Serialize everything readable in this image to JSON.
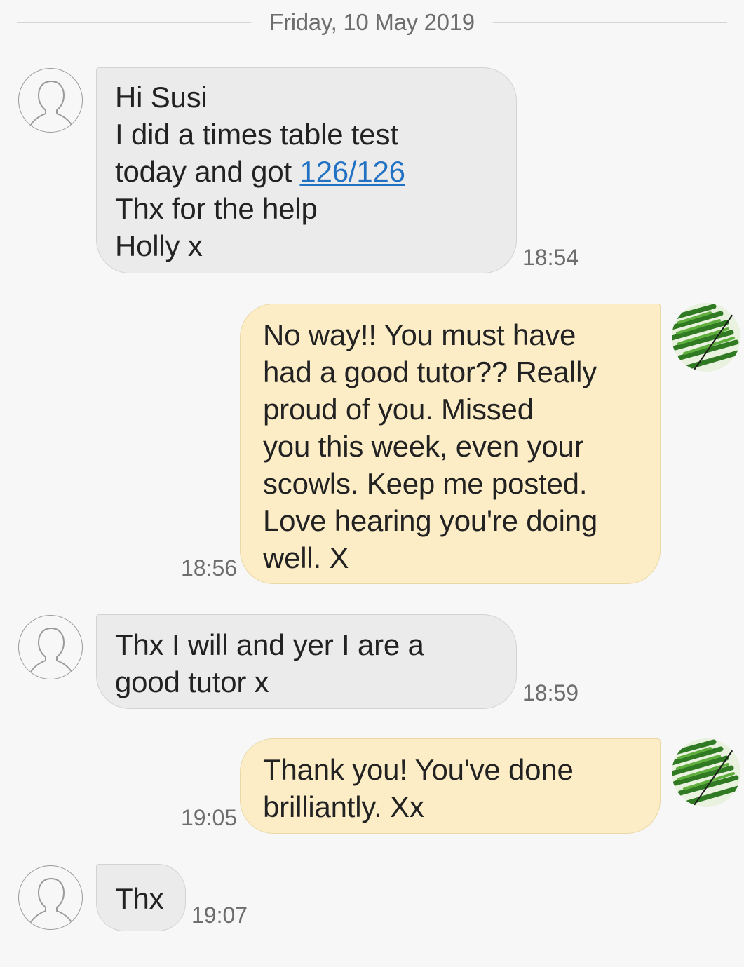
{
  "date_separator": "Friday, 10 May 2019",
  "messages": [
    {
      "direction": "incoming",
      "lines": [
        "Hi Susi",
        "I did a times table test",
        "today and got ",
        "Thx for the help",
        "Holly x"
      ],
      "link": "126/126",
      "time": "18:54"
    },
    {
      "direction": "outgoing",
      "lines": [
        "No way!! You must have",
        "had a good tutor?? Really",
        "proud of you. Missed",
        "you this week, even your",
        "scowls. Keep me posted.",
        "Love hearing you're doing",
        "well. X"
      ],
      "time": "18:56"
    },
    {
      "direction": "incoming",
      "lines": [
        "Thx I will and yer I are a",
        "good tutor x"
      ],
      "time": "18:59"
    },
    {
      "direction": "outgoing",
      "lines": [
        "Thank you! You've done",
        "brilliantly. Xx"
      ],
      "time": "19:05"
    },
    {
      "direction": "incoming",
      "lines": [
        "Thx"
      ],
      "time": "19:07"
    }
  ],
  "colors": {
    "background": "#f7f7f7",
    "incoming_bubble": "#ebebeb",
    "outgoing_bubble": "#fcedc6",
    "link": "#2272c4",
    "timestamp": "#6d6d6d"
  },
  "icons": {
    "contact_avatar": "default-person-avatar-icon",
    "own_avatar": "fern-leaf-photo-avatar"
  }
}
